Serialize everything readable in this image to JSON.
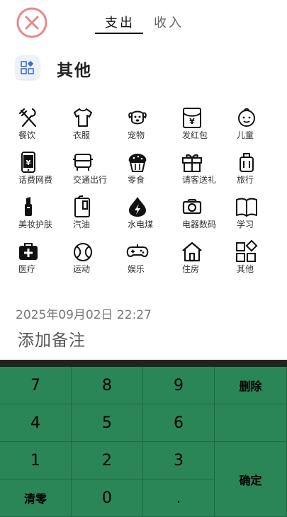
{
  "header": {
    "tabs": [
      {
        "label": "支出",
        "active": true
      },
      {
        "label": "收入",
        "active": false
      }
    ]
  },
  "selected_category": {
    "label": "其他",
    "icon": "category-grid-icon"
  },
  "categories": [
    {
      "label": "餐饮",
      "icon": "utensils-icon"
    },
    {
      "label": "衣服",
      "icon": "tshirt-icon"
    },
    {
      "label": "宠物",
      "icon": "dog-icon"
    },
    {
      "label": "发红包",
      "icon": "red-envelope-icon"
    },
    {
      "label": "儿童",
      "icon": "baby-icon"
    },
    {
      "label": "话费网费",
      "icon": "phone-icon"
    },
    {
      "label": "交通出行",
      "icon": "car-icon"
    },
    {
      "label": "零食",
      "icon": "cupcake-icon"
    },
    {
      "label": "请客送礼",
      "icon": "gift-icon"
    },
    {
      "label": "旅行",
      "icon": "luggage-icon"
    },
    {
      "label": "美妆护肤",
      "icon": "lipstick-icon"
    },
    {
      "label": "汽油",
      "icon": "fuel-icon"
    },
    {
      "label": "水电煤",
      "icon": "utility-icon"
    },
    {
      "label": "电器数码",
      "icon": "camera-icon"
    },
    {
      "label": "学习",
      "icon": "book-icon"
    },
    {
      "label": "医疗",
      "icon": "medical-kit-icon"
    },
    {
      "label": "运动",
      "icon": "ball-icon"
    },
    {
      "label": "娱乐",
      "icon": "gamepad-icon"
    },
    {
      "label": "住房",
      "icon": "house-icon"
    },
    {
      "label": "其他",
      "icon": "other-grid-icon"
    }
  ],
  "datetime": "2025年09月02日 22:27",
  "note_placeholder": "添加备注",
  "keypad": {
    "k7": "7",
    "k8": "8",
    "k9": "9",
    "delete": "删除",
    "k4": "4",
    "k5": "5",
    "k6": "6",
    "k1": "1",
    "k2": "2",
    "k3": "3",
    "confirm": "确定",
    "clear": "清零",
    "k0": "0",
    "dot": "."
  },
  "colors": {
    "keypad_bg": "#2a8656",
    "close_icon": "#e05a5a"
  }
}
